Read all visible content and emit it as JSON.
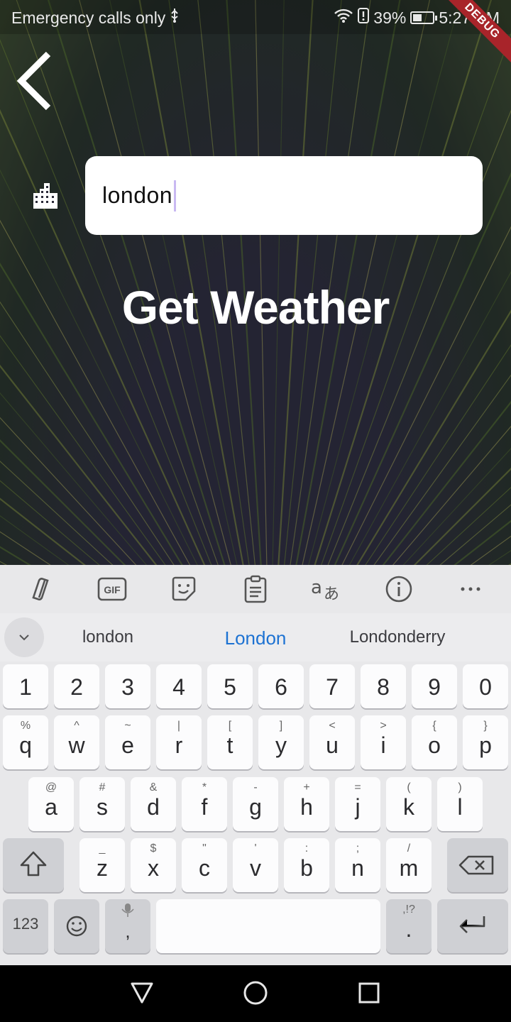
{
  "status_bar": {
    "left_text": "Emergency calls only",
    "battery": "39%",
    "time": "5:27 PM",
    "battery_level_fraction": 0.39
  },
  "debug_banner": "DEBUG",
  "search": {
    "value": "london"
  },
  "action": {
    "label": "Get Weather"
  },
  "keyboard": {
    "suggestions": [
      "london",
      "London",
      "Londonderry"
    ],
    "number_row": [
      "1",
      "2",
      "3",
      "4",
      "5",
      "6",
      "7",
      "8",
      "9",
      "0"
    ],
    "row1": [
      {
        "main": "q",
        "sub": "%"
      },
      {
        "main": "w",
        "sub": "^"
      },
      {
        "main": "e",
        "sub": "~"
      },
      {
        "main": "r",
        "sub": "|"
      },
      {
        "main": "t",
        "sub": "["
      },
      {
        "main": "y",
        "sub": "]"
      },
      {
        "main": "u",
        "sub": "<"
      },
      {
        "main": "i",
        "sub": ">"
      },
      {
        "main": "o",
        "sub": "{"
      },
      {
        "main": "p",
        "sub": "}"
      }
    ],
    "row2": [
      {
        "main": "a",
        "sub": "@"
      },
      {
        "main": "s",
        "sub": "#"
      },
      {
        "main": "d",
        "sub": "&"
      },
      {
        "main": "f",
        "sub": "*"
      },
      {
        "main": "g",
        "sub": "-"
      },
      {
        "main": "h",
        "sub": "+"
      },
      {
        "main": "j",
        "sub": "="
      },
      {
        "main": "k",
        "sub": "("
      },
      {
        "main": "l",
        "sub": ")"
      }
    ],
    "row3": [
      {
        "main": "z",
        "sub": "_"
      },
      {
        "main": "x",
        "sub": "$"
      },
      {
        "main": "c",
        "sub": "\""
      },
      {
        "main": "v",
        "sub": "'"
      },
      {
        "main": "b",
        "sub": ":"
      },
      {
        "main": "n",
        "sub": ";"
      },
      {
        "main": "m",
        "sub": "/"
      }
    ],
    "numbers_key": "123",
    "comma": ",",
    "period": ".",
    "period_sub": ",!?"
  },
  "colors": {
    "suggestion_highlight": "#1d72d2",
    "debug": "#a8242a",
    "caret": "#c9b9f2"
  }
}
